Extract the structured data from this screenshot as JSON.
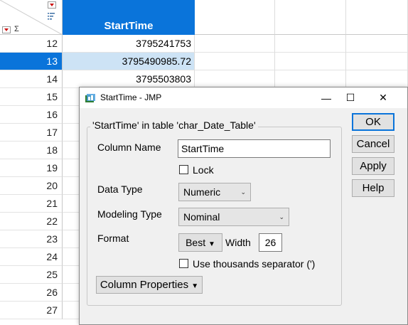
{
  "table": {
    "column_header": "StartTime",
    "rows": [
      {
        "n": "12",
        "v": "3795241753"
      },
      {
        "n": "13",
        "v": "3795490985.72",
        "selected": true
      },
      {
        "n": "14",
        "v": "3795503803"
      },
      {
        "n": "15",
        "v": ""
      },
      {
        "n": "16",
        "v": ""
      },
      {
        "n": "17",
        "v": ""
      },
      {
        "n": "18",
        "v": ""
      },
      {
        "n": "19",
        "v": ""
      },
      {
        "n": "20",
        "v": ""
      },
      {
        "n": "21",
        "v": ""
      },
      {
        "n": "22",
        "v": ""
      },
      {
        "n": "23",
        "v": ""
      },
      {
        "n": "24",
        "v": ""
      },
      {
        "n": "25",
        "v": ""
      },
      {
        "n": "26",
        "v": ""
      },
      {
        "n": "27",
        "v": ""
      }
    ],
    "header_accent": "#0a74da",
    "selected_row_bg": "#cde3f5"
  },
  "dialog": {
    "title": "StartTime - JMP",
    "group_legend": "'StartTime' in table 'char_Date_Table'",
    "column_name_label": "Column Name",
    "column_name_value": "StartTime",
    "lock_label": "Lock",
    "lock_checked": false,
    "data_type_label": "Data Type",
    "data_type_value": "Numeric",
    "modeling_type_label": "Modeling Type",
    "modeling_type_value": "Nominal",
    "format_label": "Format",
    "format_value": "Best",
    "width_label": "Width",
    "width_value": "26",
    "thousands_label": "Use thousands separator (')",
    "thousands_checked": false,
    "column_properties_label": "Column Properties",
    "buttons": {
      "ok": "OK",
      "cancel": "Cancel",
      "apply": "Apply",
      "help": "Help"
    },
    "window_controls": {
      "minimize": "—",
      "maximize": "☐",
      "close": "✕"
    }
  }
}
